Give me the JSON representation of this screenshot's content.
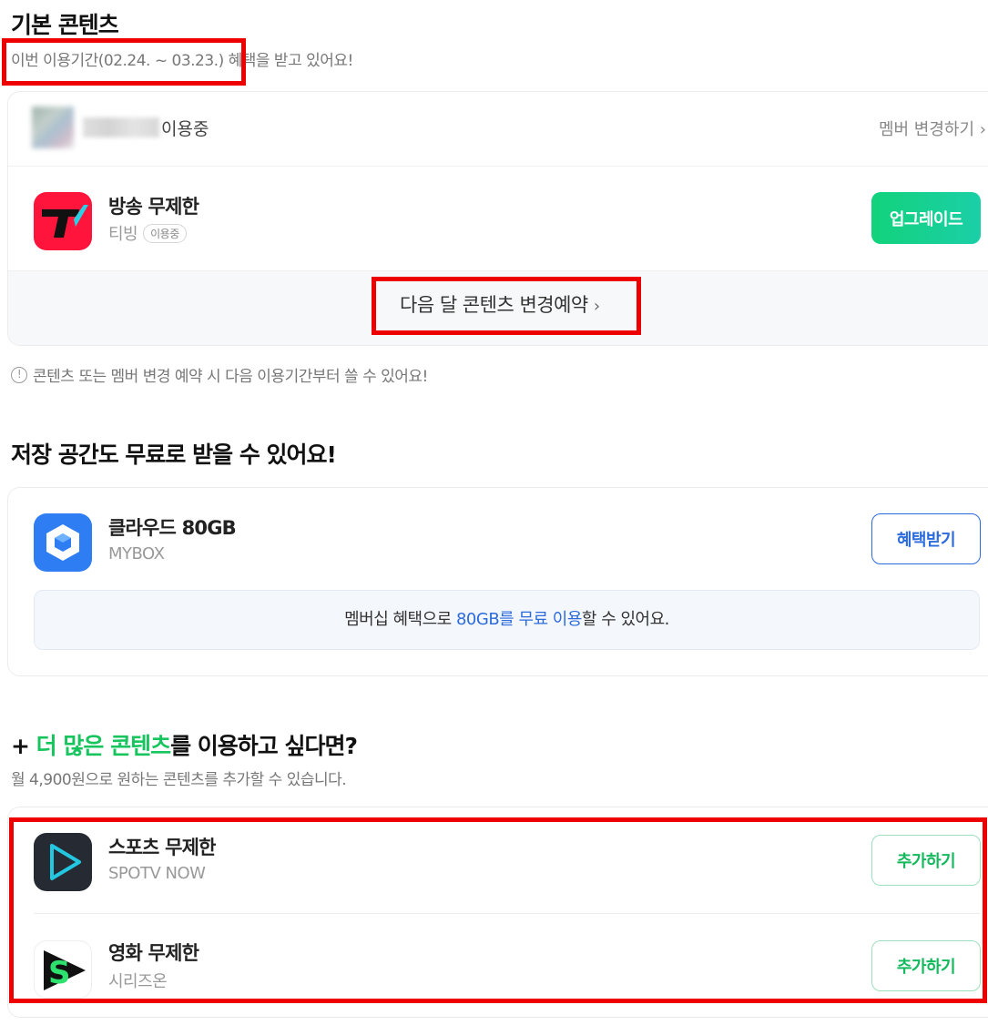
{
  "basic": {
    "title": "기본 콘텐츠",
    "period_text": "이번 이용기간(02.24. ~ 03.23.) 혜택을 받고 있어요!",
    "member_status": "이용중",
    "member_change": "멤버 변경하기",
    "item": {
      "title": "방송 무제한",
      "provider": "티빙",
      "badge": "이용중",
      "button": "업그레이드"
    },
    "reserve_link": "다음 달 콘텐츠 변경예약",
    "notice": "콘텐츠 또는 멤버 변경 예약 시 다음 이용기간부터 쓸 수 있어요!"
  },
  "storage": {
    "title": "저장 공간도 무료로 받을 수 있어요!",
    "item": {
      "title": "클라우드 80GB",
      "provider": "MYBOX",
      "button": "혜택받기"
    },
    "info_prefix": "멤버십 혜택으로 ",
    "info_highlight": "80GB를 무료 이용",
    "info_suffix": "할 수 있어요."
  },
  "more": {
    "title_plus": "+",
    "title_highlight": "더 많은 콘텐츠",
    "title_rest": "를 이용하고 싶다면?",
    "subtitle": "월 4,900원으로 원하는 콘텐츠를 추가할 수 있습니다.",
    "items": [
      {
        "title": "스포츠 무제한",
        "provider": "SPOTV NOW",
        "button": "추가하기"
      },
      {
        "title": "영화 무제한",
        "provider": "시리즈온",
        "button": "추가하기"
      }
    ]
  },
  "colors": {
    "accent_green": "#17c45e",
    "accent_blue": "#2b6bdc",
    "highlight_red": "#ee0000"
  },
  "icons": {
    "notice": "info-circle-icon",
    "chevron": "chevron-right-icon"
  }
}
